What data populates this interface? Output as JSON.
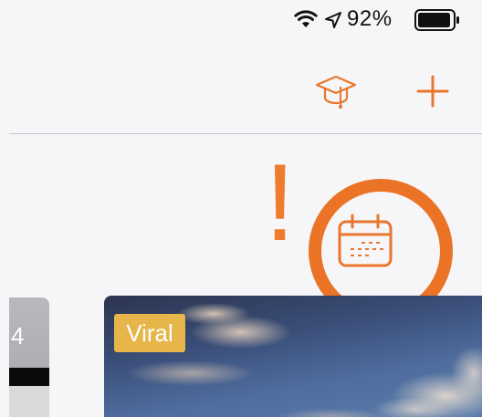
{
  "status_bar": {
    "battery_percent": "92%",
    "icons": [
      "wifi-icon",
      "location-arrow-icon",
      "battery-icon"
    ]
  },
  "nav_bar": {
    "icons": [
      "graduation-cap-icon",
      "plus-icon"
    ]
  },
  "annotation": {
    "mark": "!",
    "highlighted_icon": "calendar-icon"
  },
  "cards": {
    "left_card_number": "4",
    "main_card_badge": "Viral"
  },
  "colors": {
    "accent": "#ee7b2e",
    "ring": "#ea7325",
    "badge": "#e6b64a"
  }
}
